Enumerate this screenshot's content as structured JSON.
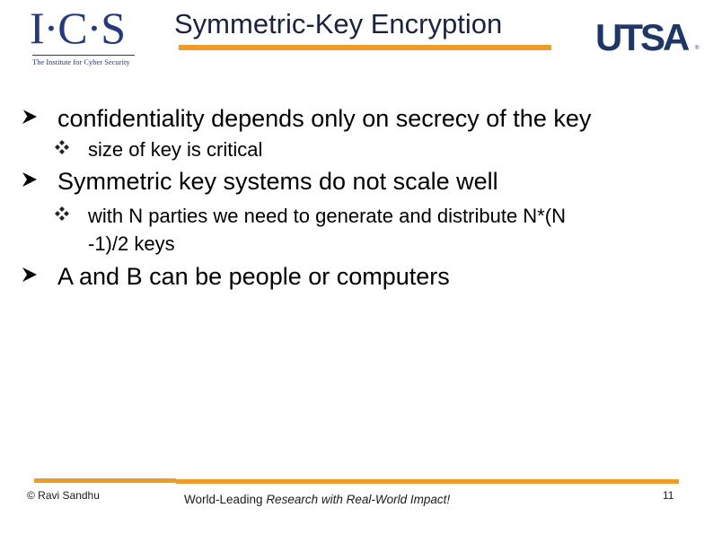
{
  "header": {
    "logo_left": {
      "letters": "I·C·S",
      "tagline": "The Institute for Cyber Security"
    },
    "title": "Symmetric-Key Encryption",
    "logo_right": {
      "text": "UTSA",
      "registered_mark": "®"
    }
  },
  "icons": {
    "level1_bullet": "arrowhead-bullet-icon",
    "level2_bullet": "four-diamond-bullet-icon"
  },
  "content": {
    "bullets": [
      {
        "text": "confidentiality depends only on secrecy of the key",
        "sub": [
          {
            "lines": [
              "size of key is critical"
            ]
          }
        ]
      },
      {
        "text": "Symmetric key systems do not scale well",
        "sub": [
          {
            "lines": [
              "with N parties we need to generate and distribute N*(N",
              "-1)/2 keys"
            ]
          }
        ]
      },
      {
        "text": "A and B can be people or computers",
        "sub": []
      }
    ]
  },
  "footer": {
    "copyright": "© Ravi  Sandhu",
    "tagline_plain": "World-Leading ",
    "tagline_italic": "Research with Real-World Impact!",
    "page_number": "11"
  },
  "colors": {
    "accent_orange": "#f09a2a",
    "logo_navy": "#253a7a",
    "utsa_navy": "#1e3766",
    "title_text": "#1a2340"
  }
}
